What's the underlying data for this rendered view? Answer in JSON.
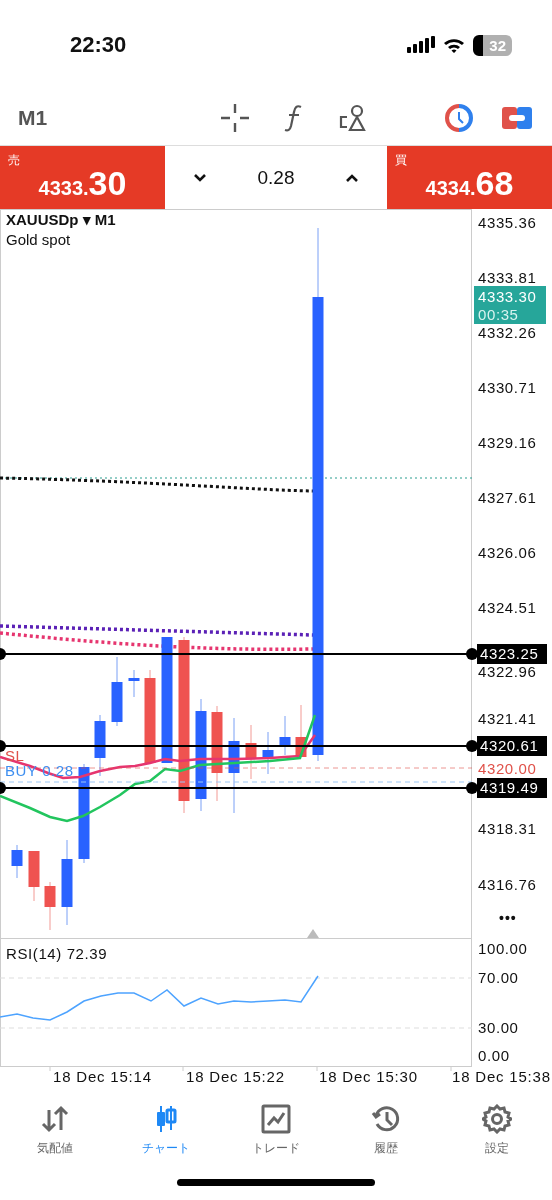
{
  "status_bar": {
    "time": "22:30",
    "battery": "32"
  },
  "toolbar": {
    "timeframe": "M1"
  },
  "quote": {
    "sell_label": "売",
    "sell_price_small": "4333.",
    "sell_price_big": "30",
    "volume": "0.28",
    "buy_label": "買",
    "buy_price_small": "4334.",
    "buy_price_big": "68"
  },
  "chart": {
    "symbol": "XAUUSDp ▾ M1",
    "description": "Gold spot",
    "price_axis": [
      "4335.36",
      "4333.81",
      "4332.26",
      "4330.71",
      "4329.16",
      "4327.61",
      "4326.06",
      "4324.51",
      "4322.96",
      "4321.41",
      "4318.31",
      "4316.76"
    ],
    "current_price": {
      "price": "4333.30",
      "countdown": "00:35"
    },
    "levels": [
      {
        "label": "4323.25",
        "kind": "line"
      },
      {
        "label": "4320.61",
        "kind": "line"
      },
      {
        "label": "4320.00",
        "kind": "stop"
      },
      {
        "label": "4319.49",
        "kind": "line"
      }
    ],
    "orders": [
      {
        "label": "SL",
        "kind": "stop"
      },
      {
        "label": "BUY 0.28",
        "kind": "buy"
      }
    ],
    "more": "•••"
  },
  "rsi": {
    "title": "RSI(14) 72.39",
    "axis": [
      "100.00",
      "70.00",
      "30.00",
      "0.00"
    ]
  },
  "time_axis": [
    "18 Dec 15:14",
    "18 Dec 15:22",
    "18 Dec 15:30",
    "18 Dec 15:38"
  ],
  "tabs": [
    {
      "label": "気配値",
      "selected": false
    },
    {
      "label": "チャート",
      "selected": true
    },
    {
      "label": "トレード",
      "selected": false
    },
    {
      "label": "履歴",
      "selected": false
    },
    {
      "label": "設定",
      "selected": false
    }
  ]
}
